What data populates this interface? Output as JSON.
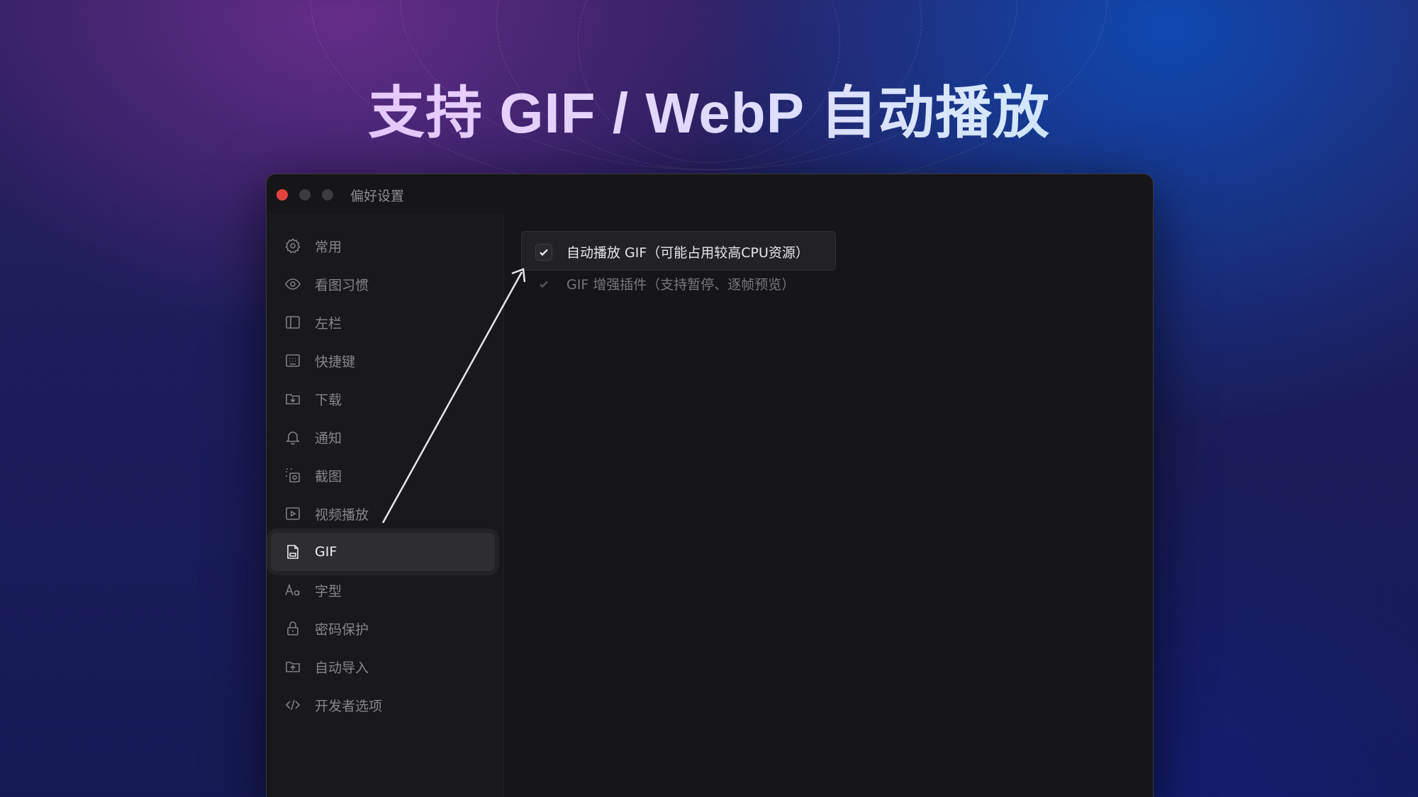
{
  "headline": "支持 GIF / WebP 自动播放",
  "window": {
    "title": "偏好设置"
  },
  "sidebar": {
    "items": [
      {
        "label": "常用",
        "icon": "gear-icon"
      },
      {
        "label": "看图习惯",
        "icon": "eye-icon"
      },
      {
        "label": "左栏",
        "icon": "sidebar-icon"
      },
      {
        "label": "快捷键",
        "icon": "keyboard-icon"
      },
      {
        "label": "下载",
        "icon": "download-folder-icon"
      },
      {
        "label": "通知",
        "icon": "bell-icon"
      },
      {
        "label": "截图",
        "icon": "screenshot-icon"
      },
      {
        "label": "视频播放",
        "icon": "play-icon"
      },
      {
        "label": "GIF",
        "icon": "gif-file-icon",
        "active": true
      },
      {
        "label": "字型",
        "icon": "font-icon"
      },
      {
        "label": "密码保护",
        "icon": "lock-icon"
      },
      {
        "label": "自动导入",
        "icon": "import-folder-icon"
      },
      {
        "label": "开发者选项",
        "icon": "code-icon"
      }
    ]
  },
  "options": {
    "autoplay_gif": {
      "label": "自动播放 GIF（可能占用较高CPU资源）",
      "checked": true
    },
    "gif_plugin": {
      "label": "GIF 增强插件（支持暂停、逐帧预览）",
      "checked": true,
      "disabled": true
    }
  },
  "colors": {
    "accent_window": "#161618",
    "active_item": "#2e2e32",
    "close_button": "#e0443e"
  }
}
